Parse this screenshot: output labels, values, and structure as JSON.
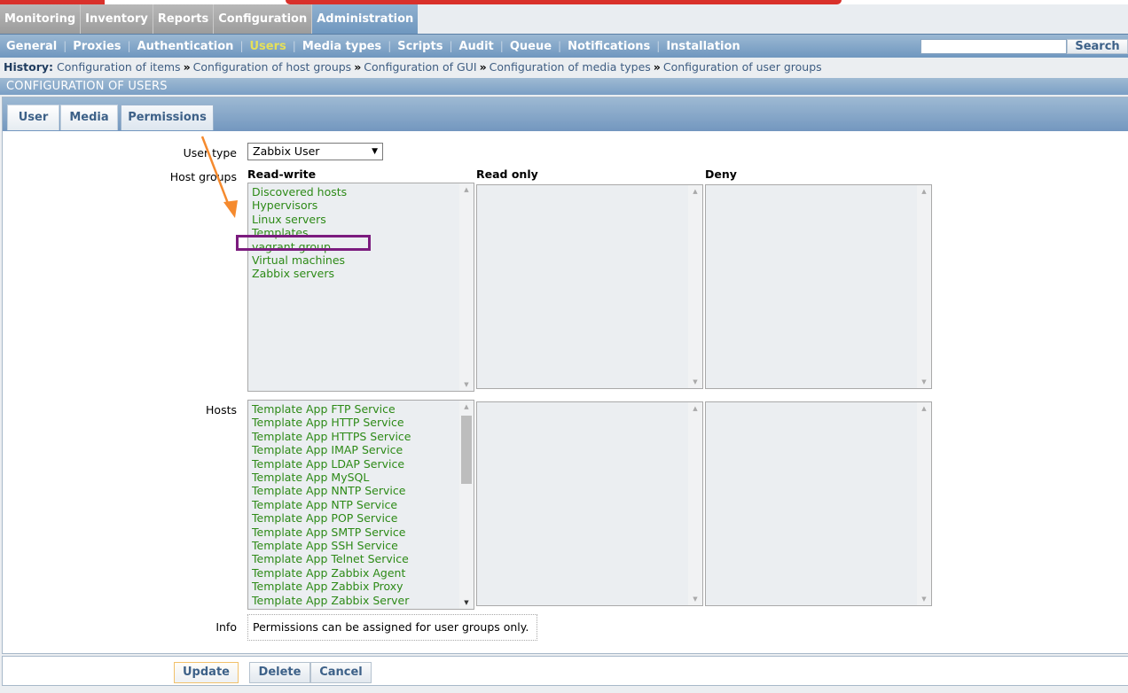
{
  "main_menu": [
    {
      "label": "Monitoring",
      "active": false
    },
    {
      "label": "Inventory",
      "active": false
    },
    {
      "label": "Reports",
      "active": false
    },
    {
      "label": "Configuration",
      "active": false
    },
    {
      "label": "Administration",
      "active": true
    }
  ],
  "sub_menu": [
    {
      "label": "General",
      "active": false
    },
    {
      "label": "Proxies",
      "active": false
    },
    {
      "label": "Authentication",
      "active": false
    },
    {
      "label": "Users",
      "active": true
    },
    {
      "label": "Media types",
      "active": false
    },
    {
      "label": "Scripts",
      "active": false
    },
    {
      "label": "Audit",
      "active": false
    },
    {
      "label": "Queue",
      "active": false
    },
    {
      "label": "Notifications",
      "active": false
    },
    {
      "label": "Installation",
      "active": false
    }
  ],
  "search": {
    "value": "",
    "placeholder": "",
    "button_label": "Search"
  },
  "history": {
    "label": "History:",
    "separator": "»",
    "items": [
      "Configuration of items",
      "Configuration of host groups",
      "Configuration of GUI",
      "Configuration of media types",
      "Configuration of user groups"
    ]
  },
  "section_title": "CONFIGURATION OF USERS",
  "tabs": [
    {
      "label": "User",
      "active": false
    },
    {
      "label": "Media",
      "active": false
    },
    {
      "label": "Permissions",
      "active": true
    }
  ],
  "form": {
    "user_type_label": "User type",
    "user_type_value": "Zabbix User",
    "host_groups_label": "Host groups",
    "hosts_label": "Hosts",
    "info_label": "Info",
    "info_text": "Permissions can be assigned for user groups only.",
    "columns": {
      "read_write": "Read-write",
      "read_only": "Read only",
      "deny": "Deny"
    },
    "host_groups": {
      "read_write": [
        "Discovered hosts",
        "Hypervisors",
        "Linux servers",
        "Templates",
        "vagrant group",
        "Virtual machines",
        "Zabbix servers"
      ],
      "read_only": [],
      "deny": []
    },
    "hosts": {
      "read_write": [
        "Template App FTP Service",
        "Template App HTTP Service",
        "Template App HTTPS Service",
        "Template App IMAP Service",
        "Template App LDAP Service",
        "Template App MySQL",
        "Template App NNTP Service",
        "Template App NTP Service",
        "Template App POP Service",
        "Template App SMTP Service",
        "Template App SSH Service",
        "Template App Telnet Service",
        "Template App Zabbix Agent",
        "Template App Zabbix Proxy",
        "Template App Zabbix Server"
      ],
      "read_only": [],
      "deny": []
    }
  },
  "annotation": {
    "highlighted_item": "vagrant group",
    "arrow_color": "#f58a2e",
    "box_color": "#7b1b7e"
  },
  "buttons": {
    "update": "Update",
    "delete": "Delete",
    "cancel": "Cancel"
  },
  "colors": {
    "item_green": "#2d8a17",
    "active_submenu": "#e5e05a",
    "header_blue": "#7a9fc5"
  }
}
